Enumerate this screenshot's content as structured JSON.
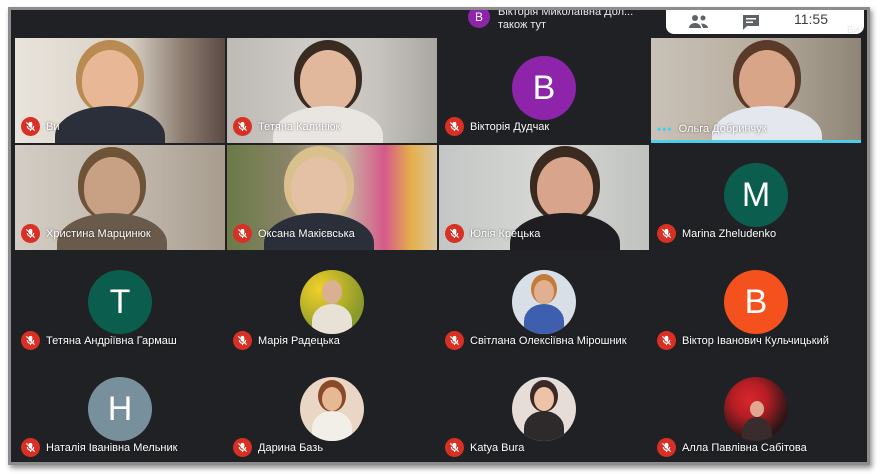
{
  "notification": {
    "avatar_letter": "В",
    "line1": "Вікторія Миколаївна Дол...",
    "line2": "також тут"
  },
  "topbar": {
    "time": "11:55",
    "people_icon": "people-icon",
    "chat_icon": "chat-icon"
  },
  "corner_tag": "Ви",
  "colors": {
    "background": "#202124",
    "tile": "#3c4043",
    "muted_mic": "#d93025",
    "speaking": "#4ecde6"
  },
  "participants": [
    {
      "name": "Ви",
      "muted": true
    },
    {
      "name": "Тетяна Калинюк",
      "muted": true
    },
    {
      "name": "Вікторія Дудчак",
      "muted": true,
      "avatar_letter": "В"
    },
    {
      "name": "Ольга Добринчук",
      "muted": false,
      "speaking": true
    },
    {
      "name": "Христина Марцинюк",
      "muted": true
    },
    {
      "name": "Оксана Макієвська",
      "muted": true
    },
    {
      "name": "Юлія Крецька",
      "muted": true
    },
    {
      "name": "Marina Zheludenko",
      "muted": true,
      "avatar_letter": "M"
    },
    {
      "name": "Тетяна Андріївна Гармаш",
      "muted": true,
      "avatar_letter": "T"
    },
    {
      "name": "Марія Радецька",
      "muted": true
    },
    {
      "name": "Світлана Олексіївна Мірошник",
      "muted": true
    },
    {
      "name": "Віктор Іванович Кульчицький",
      "muted": true,
      "avatar_letter": "B"
    },
    {
      "name": "Наталія Іванівна Мельник",
      "muted": true,
      "avatar_letter": "H"
    },
    {
      "name": "Дарина Базь",
      "muted": true
    },
    {
      "name": "Katya Bura",
      "muted": true
    },
    {
      "name": "Алла Павлівна Сабітова",
      "muted": true
    }
  ]
}
